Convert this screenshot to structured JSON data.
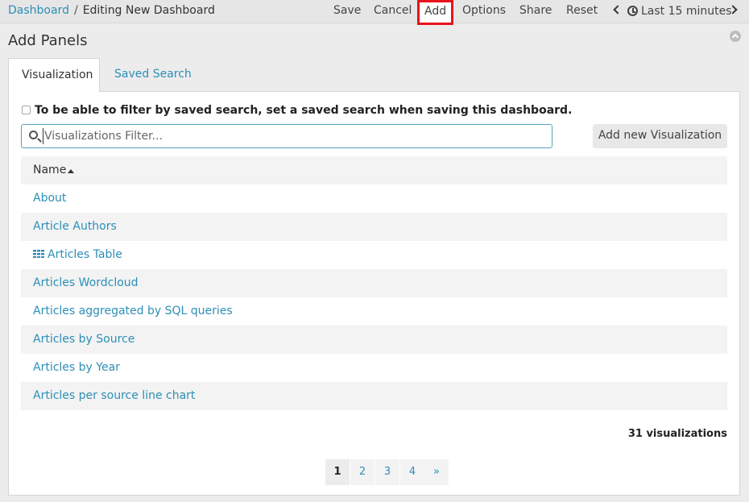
{
  "breadcrumb": {
    "root": "Dashboard",
    "separator": "/",
    "current": "Editing New Dashboard"
  },
  "menu": {
    "save": "Save",
    "cancel": "Cancel",
    "add": "Add",
    "options": "Options",
    "share": "Share",
    "reset": "Reset",
    "time_range": "Last 15 minutes"
  },
  "panel": {
    "title": "Add Panels"
  },
  "tabs": [
    {
      "label": "Visualization"
    },
    {
      "label": "Saved Search"
    }
  ],
  "notice": "To be able to filter by saved search, set a saved search when saving this dashboard.",
  "search": {
    "placeholder": "Visualizations Filter...",
    "value": ""
  },
  "add_new_button": "Add new Visualization",
  "table": {
    "header": "Name",
    "rows": [
      {
        "label": "About"
      },
      {
        "label": "Article Authors"
      },
      {
        "label": "Articles Table",
        "icon": "table-grid-icon"
      },
      {
        "label": "Articles Wordcloud"
      },
      {
        "label": "Articles aggregated by SQL queries"
      },
      {
        "label": "Articles by Source"
      },
      {
        "label": "Articles by Year"
      },
      {
        "label": "Articles per source line chart"
      }
    ]
  },
  "count_label": "31 visualizations",
  "pagination": {
    "pages": [
      "1",
      "2",
      "3",
      "4"
    ],
    "next": "»",
    "current": "1"
  },
  "colors": {
    "link": "#2c8fb6",
    "highlight_border": "#e8141b",
    "row_alt": "#f3f3f3"
  }
}
